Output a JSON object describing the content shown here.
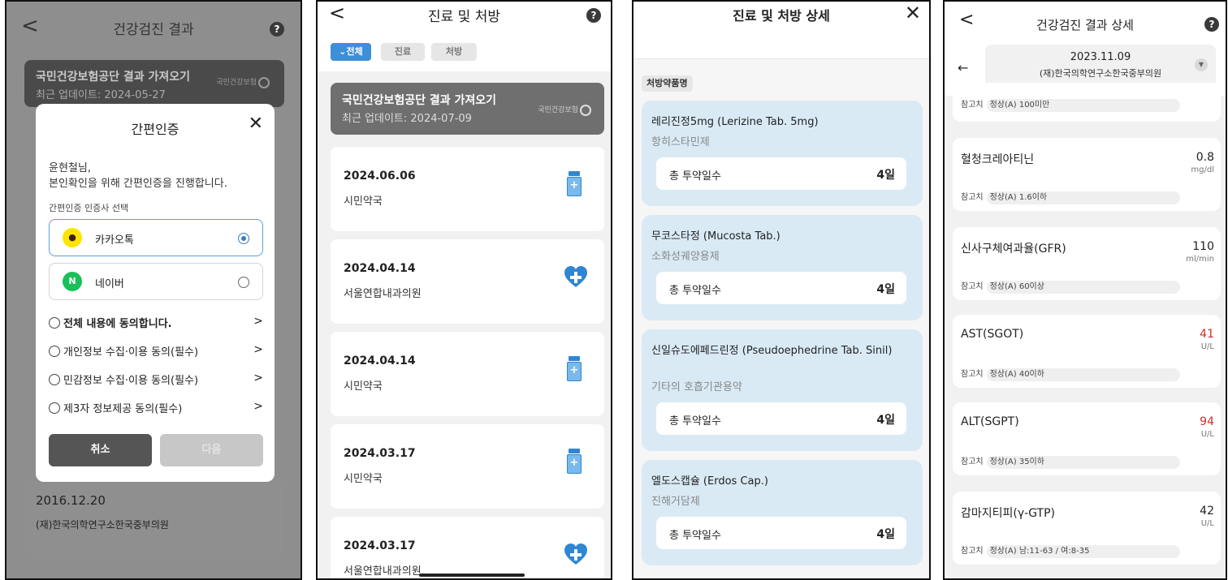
{
  "screen1": {
    "title": "건강검진 결과",
    "help": "?",
    "back": "<",
    "nhis": {
      "title": "국민건강보험공단 결과 가져오기",
      "updated": "최근 업데이트: 2024-05-27",
      "logo": "국민건강보험"
    },
    "modal": {
      "title": "간편인증",
      "close": "✕",
      "greeting_name": "윤현철님,",
      "greeting_text": "본인확인을 위해 간편인증을 진행합니다.",
      "provider_label": "간편인증 인증사 선택",
      "providers": [
        {
          "logo": "●",
          "name": "카카오톡",
          "selected": true
        },
        {
          "logo": "N",
          "name": "네이버",
          "selected": false
        }
      ],
      "agreements": [
        {
          "label": "전체 내용에 동의합니다.",
          "bold": true
        },
        {
          "label": "개인정보 수집·이용 동의(필수)",
          "bold": false
        },
        {
          "label": "민감정보 수집·이용 동의(필수)",
          "bold": false
        },
        {
          "label": "제3자 정보제공 동의(필수)",
          "bold": false
        }
      ],
      "chevron": ">",
      "cancel": "취소",
      "next": "다음"
    },
    "history": {
      "date": "2016.12.20",
      "hospital": "(재)한국의학연구소한국중부의원"
    }
  },
  "screen2": {
    "title": "진료 및 처방",
    "help": "?",
    "back": "<",
    "filters": [
      "⌄전체",
      "진료",
      "처방"
    ],
    "nhis": {
      "title": "국민건강보험공단 결과 가져오기",
      "updated": "최근 업데이트: 2024-07-09",
      "logo": "국민건강보험"
    },
    "records": [
      {
        "date": "2024.06.06",
        "place": "시민약국",
        "icon": "pill-bottle-icon"
      },
      {
        "date": "2024.04.14",
        "place": "서울연합내과의원",
        "icon": "heart-plus-icon"
      },
      {
        "date": "2024.04.14",
        "place": "시민약국",
        "icon": "pill-bottle-icon"
      },
      {
        "date": "2024.03.17",
        "place": "시민약국",
        "icon": "pill-bottle-icon"
      },
      {
        "date": "2024.03.17",
        "place": "서울연합내과의원",
        "icon": "heart-plus-icon"
      }
    ]
  },
  "screen3": {
    "title": "진료 및 처방 상세",
    "close": "✕",
    "section": "처방약품명",
    "drugs": [
      {
        "name": "레리진정5mg (Lerizine Tab. 5mg)",
        "class": "항히스타민제",
        "days_label": "총 투약일수",
        "days": "4일"
      },
      {
        "name": "무코스타정 (Mucosta Tab.)",
        "class": "소화성궤양용제",
        "days_label": "총 투약일수",
        "days": "4일"
      },
      {
        "name": "신일슈도에페드린정 (Pseudoephedrine Tab. Sinil)",
        "class": "기타의 호흡기관용약",
        "days_label": "총 투약일수",
        "days": "4일"
      },
      {
        "name": "엘도스캡슐 (Erdos Cap.)",
        "class": "진해거담제",
        "days_label": "총 투약일수",
        "days": "4일"
      }
    ]
  },
  "screen4": {
    "title": "건강검진 결과 상세",
    "help": "?",
    "back": "<",
    "prev_arrow": "←",
    "date": "2023.11.09",
    "hospital": "(재)한국의학연구소한국중부의원",
    "ref_label": "참고치",
    "top_ref": "정상(A) 100미만",
    "items": [
      {
        "name": "혈청크레아티닌",
        "value": "0.8",
        "unit": "mg/dl",
        "ref": "정상(A) 1.6이하",
        "abnormal": false
      },
      {
        "name": "신사구체여과율(GFR)",
        "value": "110",
        "unit": "ml/min",
        "ref": "정상(A) 60이상",
        "abnormal": false
      },
      {
        "name": "AST(SGOT)",
        "value": "41",
        "unit": "U/L",
        "ref": "정상(A) 40이하",
        "abnormal": true
      },
      {
        "name": "ALT(SGPT)",
        "value": "94",
        "unit": "U/L",
        "ref": "정상(A) 35이하",
        "abnormal": true
      },
      {
        "name": "감마지티피(γ-GTP)",
        "value": "42",
        "unit": "U/L",
        "ref": "정상(A) 남:11-63 / 여:8-35",
        "abnormal": false
      }
    ]
  },
  "colors": {
    "accent": "#3d8fd6",
    "abnormal": "#d22c2c",
    "drug_card": "#d9eaf5",
    "kakao": "#fee500",
    "naver": "#19c05a"
  }
}
